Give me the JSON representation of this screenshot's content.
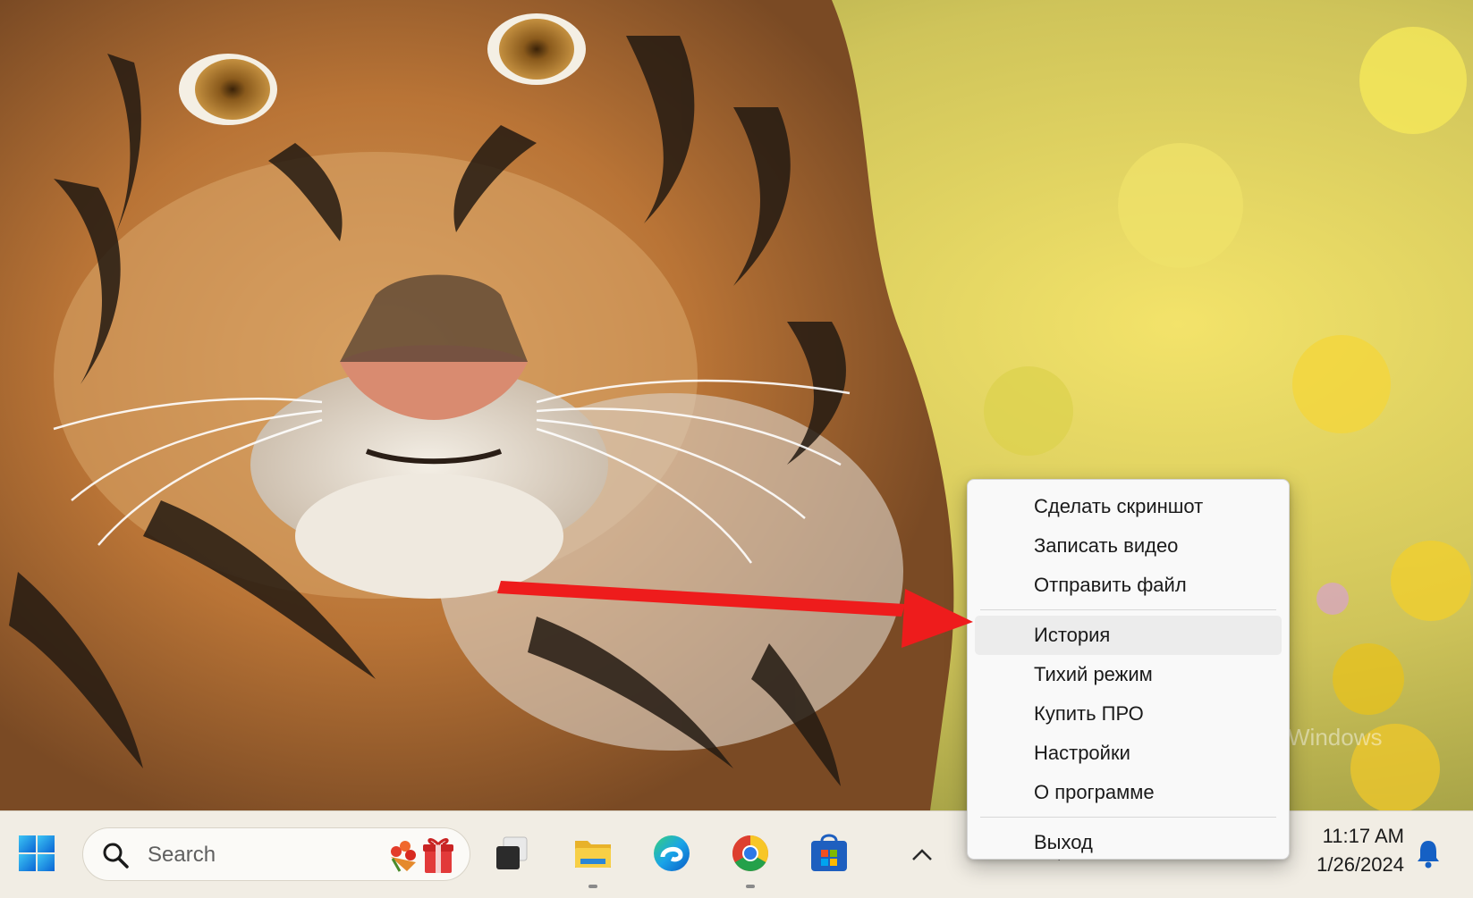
{
  "wallpaper": {
    "description_icon": "tiger-wallpaper"
  },
  "watermark": {
    "text": "Windows"
  },
  "context_menu": {
    "items": [
      {
        "label": "Сделать скриншот"
      },
      {
        "label": "Записать видео"
      },
      {
        "label": "Отправить файл"
      },
      {
        "label": "История"
      },
      {
        "label": "Тихий режим"
      },
      {
        "label": "Купить ПРО"
      },
      {
        "label": "Настройки"
      },
      {
        "label": "О программе"
      },
      {
        "label": "Выход"
      }
    ],
    "highlighted": "История"
  },
  "taskbar": {
    "search": {
      "placeholder": "Search"
    },
    "apps": [
      {
        "icon": "windows-start-icon"
      },
      {
        "icon": "task-view-icon"
      },
      {
        "icon": "file-explorer-icon"
      },
      {
        "icon": "edge-icon"
      },
      {
        "icon": "chrome-icon"
      },
      {
        "icon": "microsoft-store-icon"
      }
    ],
    "clock": {
      "time": "11:17 AM",
      "date": "1/26/2024"
    }
  },
  "colors": {
    "arrow": "#ee1c1c",
    "menu_bg": "#f9f9f9",
    "highlight": "#ececec"
  }
}
